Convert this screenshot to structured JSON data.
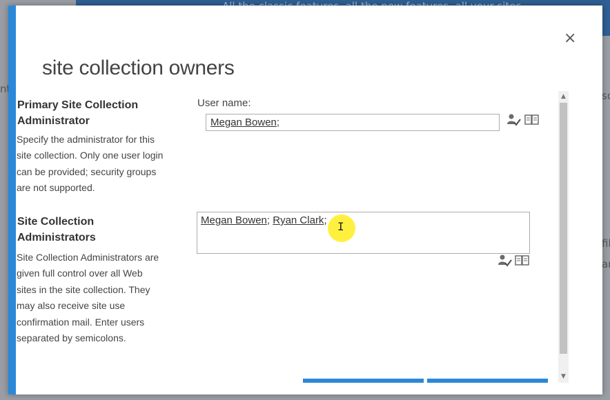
{
  "background": {
    "banner_text": "All the classic features, all the new features, all your sites",
    "left_edge_text": "nt",
    "right_edge_text_1": "so",
    "right_edge_text_2": "fil",
    "right_edge_text_3": "ar"
  },
  "dialog": {
    "title": "site collection owners",
    "close_label": "×"
  },
  "primary": {
    "title_line1": "Primary Site Collection",
    "title_line2": "Administrator",
    "desc_lines": [
      "Specify the administrator for this",
      "site collection. Only one user login",
      "can be provided; security groups",
      "are not supported."
    ],
    "field_label": "User name:",
    "value": "Megan Bowen",
    "separator": ";"
  },
  "admins": {
    "title_line1": "Site Collection",
    "title_line2": "Administrators",
    "desc_lines": [
      "Site Collection Administrators are",
      "given full control over all Web",
      "sites in the site collection. They",
      "may also receive site use",
      "confirmation mail. Enter users",
      "separated by semicolons."
    ],
    "user1": "Megan Bowen",
    "separator": "; ",
    "user2": "Ryan Clark",
    "trailing": ";"
  },
  "icons": {
    "check_names": "check-names-icon",
    "browse": "address-book-icon"
  },
  "colors": {
    "accent": "#2b88d8",
    "highlight": "#ffeb00"
  }
}
